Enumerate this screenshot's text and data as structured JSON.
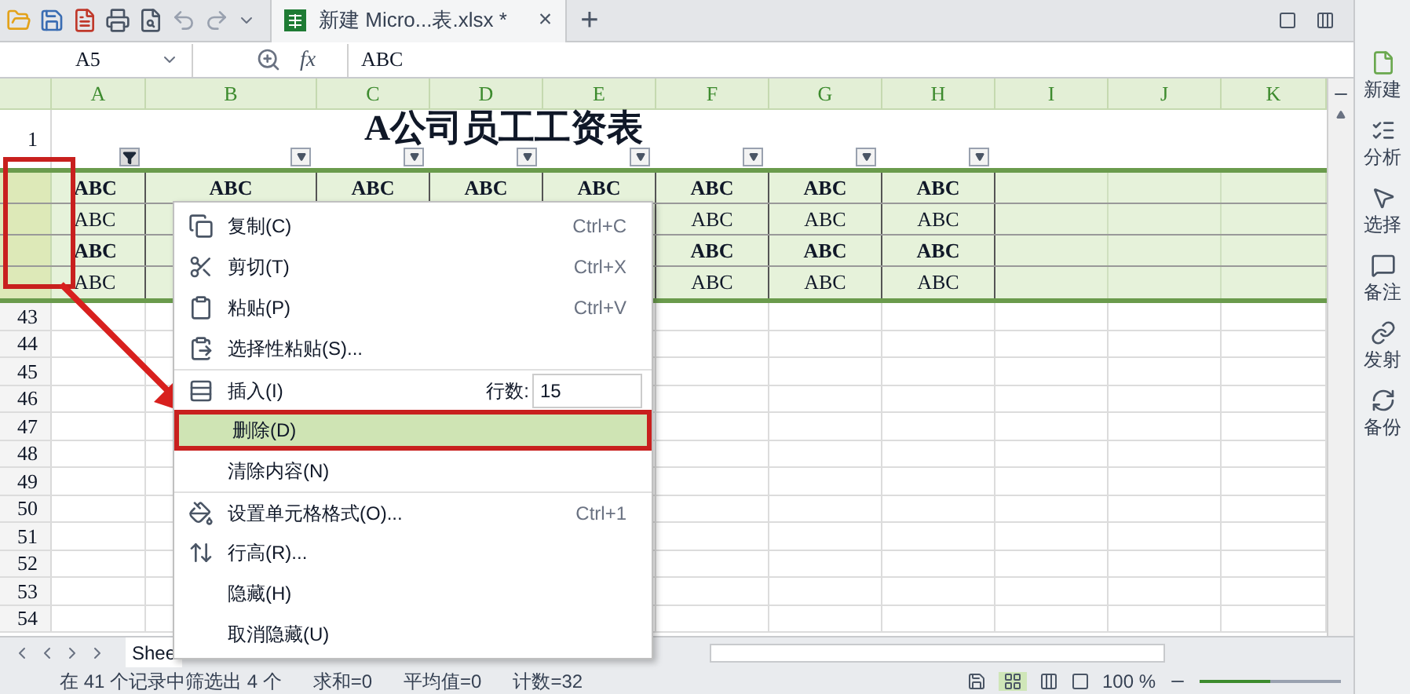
{
  "toolbar": {
    "document_tab": {
      "title": "新建 Micro...表.xlsx *",
      "close": "×"
    },
    "new_tab": "+"
  },
  "formula_bar": {
    "name_box": "A5",
    "fx": "fx",
    "value": "ABC"
  },
  "columns": [
    "A",
    "B",
    "C",
    "D",
    "E",
    "F",
    "G",
    "H",
    "I",
    "J",
    "K"
  ],
  "title_row": {
    "row_number": "1",
    "title": "A公司员工工资表",
    "filters": [
      {
        "active": true
      },
      {
        "active": false
      },
      {
        "active": false
      },
      {
        "active": false
      },
      {
        "active": false
      },
      {
        "active": false
      },
      {
        "active": false
      },
      {
        "active": false
      }
    ]
  },
  "data_rows": [
    {
      "bold": true,
      "cells": [
        "ABC",
        "ABC",
        "ABC",
        "ABC",
        "ABC",
        "ABC",
        "ABC",
        "ABC"
      ]
    },
    {
      "bold": false,
      "cells": [
        "ABC",
        null,
        null,
        null,
        null,
        "ABC",
        "ABC",
        "ABC"
      ]
    },
    {
      "bold": true,
      "cells": [
        "ABC",
        null,
        null,
        null,
        null,
        "ABC",
        "ABC",
        "ABC"
      ]
    },
    {
      "bold": false,
      "cells": [
        "ABC",
        null,
        null,
        null,
        null,
        "ABC",
        "ABC",
        "ABC"
      ]
    }
  ],
  "empty_rows": [
    "43",
    "44",
    "45",
    "46",
    "47",
    "48",
    "49",
    "50",
    "51",
    "52",
    "53",
    "54"
  ],
  "context_menu": {
    "items": [
      {
        "label": "复制(C)",
        "shortcut": "Ctrl+C",
        "divider_above": false,
        "selected": false,
        "kind": "item"
      },
      {
        "label": "剪切(T)",
        "shortcut": "Ctrl+X",
        "divider_above": false,
        "selected": false,
        "kind": "item"
      },
      {
        "label": "粘贴(P)",
        "shortcut": "Ctrl+V",
        "divider_above": false,
        "selected": false,
        "kind": "item"
      },
      {
        "label": "选择性粘贴(S)...",
        "divider_above": false,
        "selected": false,
        "kind": "item"
      },
      {
        "label": "插入(I)",
        "count_label": "行数:",
        "count": "15",
        "divider_above": true,
        "selected": false,
        "kind": "insert"
      },
      {
        "label": "删除(D)",
        "divider_above": false,
        "selected": true,
        "kind": "item"
      },
      {
        "label": "清除内容(N)",
        "divider_above": false,
        "selected": false,
        "kind": "item"
      },
      {
        "label": "设置单元格格式(O)...",
        "shortcut": "Ctrl+1",
        "divider_above": true,
        "selected": false,
        "kind": "item"
      },
      {
        "label": "行高(R)...",
        "divider_above": false,
        "selected": false,
        "kind": "item"
      },
      {
        "label": "隐藏(H)",
        "divider_above": false,
        "selected": false,
        "kind": "item"
      },
      {
        "label": "取消隐藏(U)",
        "divider_above": false,
        "selected": false,
        "kind": "item"
      }
    ]
  },
  "sidebar": {
    "items": [
      {
        "label": "新建"
      },
      {
        "label": "分析"
      },
      {
        "label": "选择"
      },
      {
        "label": "备注"
      },
      {
        "label": "发射"
      },
      {
        "label": "备份"
      }
    ]
  },
  "sheet_tabs": [
    {
      "label": "Shee",
      "selected": true
    }
  ],
  "status_bar": {
    "texts": [
      "在 41 个记录中筛选出 4 个",
      "求和=0",
      "平均值=0",
      "计数=32"
    ],
    "zoom": "100 %",
    "zoom_slider": {
      "level": 0.5
    }
  }
}
